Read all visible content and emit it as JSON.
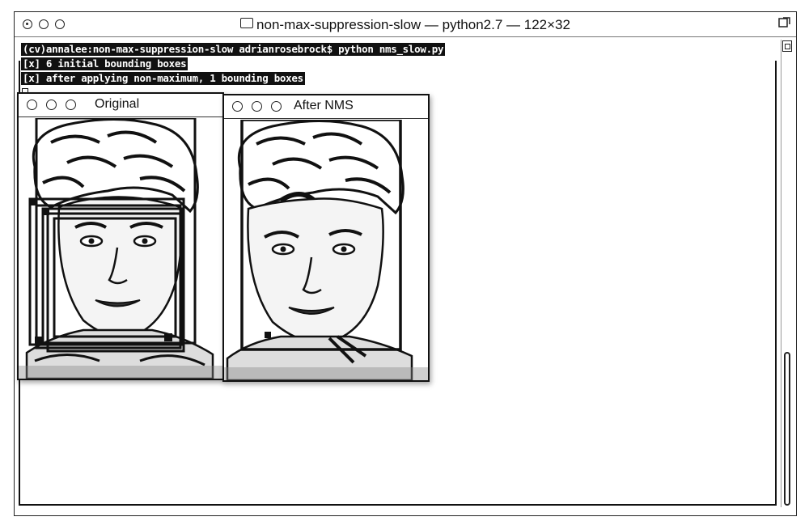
{
  "terminal": {
    "title": "non-max-suppression-slow — python2.7 — 122×32",
    "lines": [
      "(cv)annalee:non-max-suppression-slow adrianrosebrock$ python nms_slow.py",
      "[x] 6 initial bounding boxes",
      "[x] after applying non-maximum, 1 bounding boxes"
    ]
  },
  "windows": {
    "original": {
      "title": "Original"
    },
    "after_nms": {
      "title": "After NMS"
    }
  },
  "colors": {
    "ink": "#111111",
    "paper": "#ffffff"
  },
  "icons": {
    "folder": "folder-icon",
    "resize": "resize-icon",
    "scroll": "scroll-split-icon"
  }
}
